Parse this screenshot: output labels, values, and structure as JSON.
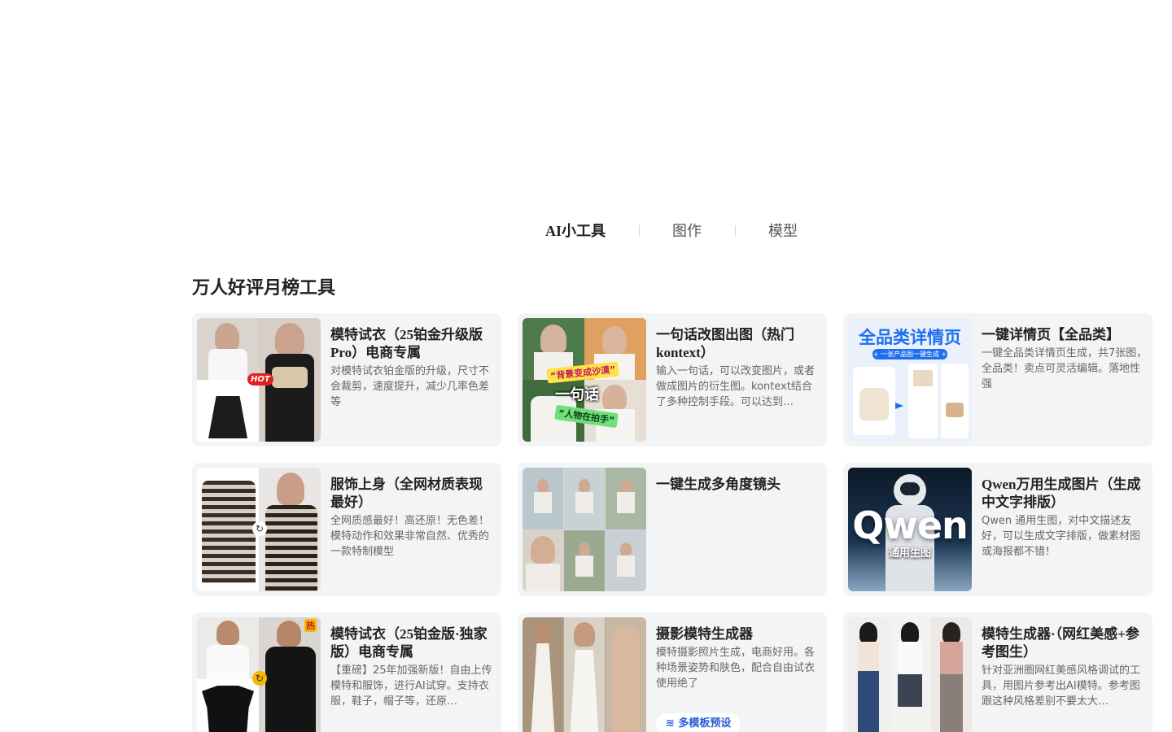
{
  "tabs": [
    {
      "label": "AI小工具",
      "active": true
    },
    {
      "label": "图作",
      "active": false
    },
    {
      "label": "模型",
      "active": false
    }
  ],
  "section_title": "万人好评月榜工具",
  "cards": [
    {
      "title": "模特试衣（25铂金升级版Pro）电商专属",
      "desc": "对模特试衣铂金版的升级，尺寸不会裁剪，速度提升，减少几率色差等",
      "badge": "HOT"
    },
    {
      "title": "一句话改图出图（热门kontext）",
      "desc": "输入一句话，可以改变图片，或者做成图片的衍生图。kontext结合了多种控制手段。可以达到…",
      "overlay_top": "“背景变成沙漠”",
      "overlay_mid": "一句话",
      "overlay_bottom": "“人物在拍手”"
    },
    {
      "title": "一键详情页【全品类】",
      "desc": "一键全品类详情页生成，共7张图，全品类！卖点可灵活编辑。落地性强",
      "thumb_headline": "全品类详情页",
      "thumb_sub": "+ 一张产品图一键生成 +"
    },
    {
      "title": "服饰上身（全网材质表现最好）",
      "desc": "全网质感最好！高还原！无色差！模特动作和效果非常自然、优秀的一款特制模型"
    },
    {
      "title": "一键生成多角度镜头",
      "desc": ""
    },
    {
      "title": "Qwen万用生成图片（生成中文字排版）",
      "desc": "Qwen 通用生图，对中文描述友好，可以生成文字排版，做素材图或海报都不错！",
      "thumb_brand": "Qwen",
      "thumb_sub": "通用生图"
    },
    {
      "title": "模特试衣（25铂金版·独家版）电商专属",
      "desc": "【重磅】25年加强新版！自由上传模特和服饰，进行AI试穿。支持衣服，鞋子，帽子等，还原…",
      "badge": "热"
    },
    {
      "title": "摄影模特生成器",
      "desc": "模特摄影照片生成，电商好用。各种场景姿势和肤色，配合自由试衣使用绝了",
      "pill": "≋ 多模板预设"
    },
    {
      "title": "模特生成器·（网红美感+参考图生）",
      "desc": "针对亚洲圈网红美感风格调试的工具，用图片参考出AI模特。参考图跟这种风格差别不要太大…"
    }
  ],
  "colors": {
    "card_bg": "#f3f4f6",
    "accent_blue": "#2a5bd7",
    "hot_red": "#e02020",
    "badge_yellow": "#f5b800"
  }
}
